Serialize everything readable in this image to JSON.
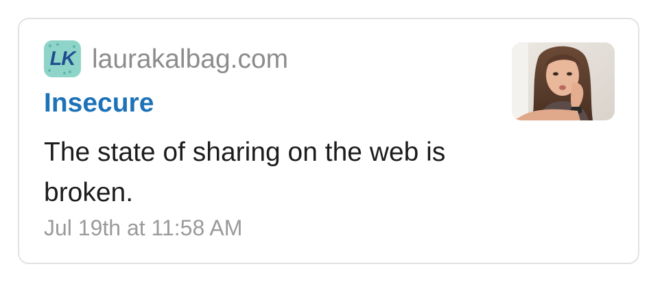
{
  "card": {
    "site_icon_name": "laurakalbag-logo-icon",
    "site_icon_text": "LK",
    "domain": "laurakalbag.com",
    "title": "Insecure",
    "description": "The state of sharing on the web is broken.",
    "timestamp": "Jul 19th at 11:58 AM",
    "thumbnail_name": "author-photo"
  },
  "colors": {
    "title": "#1d72b8",
    "domain": "#8c8c8c",
    "text": "#1d1c1d",
    "timestamp": "#9a9a9a",
    "border": "#e2e2e2",
    "icon_bg": "#8fd4c8",
    "icon_fg": "#1f4e8f"
  }
}
